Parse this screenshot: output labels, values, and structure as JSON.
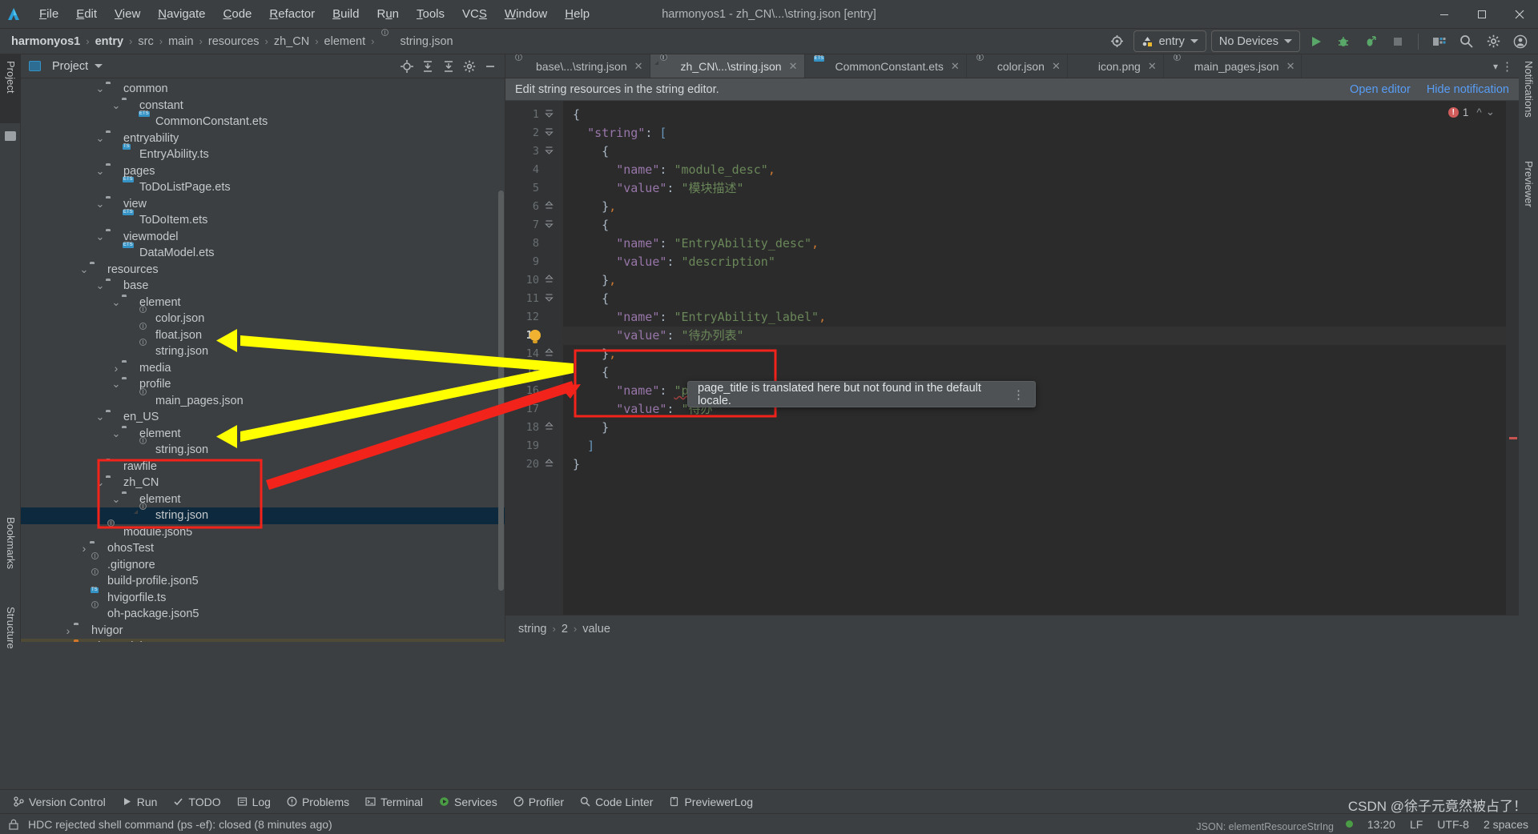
{
  "titlebar": {
    "window_title": "harmonyos1 - zh_CN\\...\\string.json [entry]",
    "menu": [
      "File",
      "Edit",
      "View",
      "Navigate",
      "Code",
      "Refactor",
      "Build",
      "Run",
      "Tools",
      "VCS",
      "Window",
      "Help"
    ],
    "controls": {
      "minimize": "─",
      "maximize": "☐",
      "close": "✕"
    }
  },
  "navbar": {
    "crumbs": [
      "harmonyos1",
      "entry",
      "src",
      "main",
      "resources",
      "zh_CN",
      "element",
      "string.json"
    ],
    "separator": "›",
    "run_config": "entry",
    "device_selector": "No Devices",
    "icons": [
      "target-icon",
      "run-icon",
      "debug-icon",
      "profile-run-icon",
      "stop-icon",
      "device-manager-icon",
      "search-icon",
      "settings-icon",
      "account-icon"
    ]
  },
  "left_strip": {
    "tabs": [
      "Project",
      "Bookmarks",
      "Structure"
    ]
  },
  "right_strip": {
    "tabs": [
      "Notifications",
      "Previewer"
    ]
  },
  "project_panel": {
    "title": "Project",
    "header_icons": [
      "locate-icon",
      "expand-all-icon",
      "collapse-all-icon",
      "settings-icon",
      "hide-icon"
    ],
    "tree": [
      {
        "label": "common",
        "indent": 4,
        "type": "folder",
        "state": "open"
      },
      {
        "label": "constant",
        "indent": 5,
        "type": "folder",
        "state": "open"
      },
      {
        "label": "CommonConstant.ets",
        "indent": 6,
        "type": "ets"
      },
      {
        "label": "entryability",
        "indent": 4,
        "type": "folder",
        "state": "open"
      },
      {
        "label": "EntryAbility.ts",
        "indent": 5,
        "type": "ts"
      },
      {
        "label": "pages",
        "indent": 4,
        "type": "folder",
        "state": "open"
      },
      {
        "label": "ToDoListPage.ets",
        "indent": 5,
        "type": "ets"
      },
      {
        "label": "view",
        "indent": 4,
        "type": "folder",
        "state": "open"
      },
      {
        "label": "ToDoItem.ets",
        "indent": 5,
        "type": "ets"
      },
      {
        "label": "viewmodel",
        "indent": 4,
        "type": "folder",
        "state": "open"
      },
      {
        "label": "DataModel.ets",
        "indent": 5,
        "type": "ets"
      },
      {
        "label": "resources",
        "indent": 3,
        "type": "folder",
        "state": "open"
      },
      {
        "label": "base",
        "indent": 4,
        "type": "folder",
        "state": "open"
      },
      {
        "label": "element",
        "indent": 5,
        "type": "folder",
        "state": "open"
      },
      {
        "label": "color.json",
        "indent": 6,
        "type": "json"
      },
      {
        "label": "float.json",
        "indent": 6,
        "type": "json"
      },
      {
        "label": "string.json",
        "indent": 6,
        "type": "json"
      },
      {
        "label": "media",
        "indent": 5,
        "type": "folder",
        "state": "closed"
      },
      {
        "label": "profile",
        "indent": 5,
        "type": "folder",
        "state": "open"
      },
      {
        "label": "main_pages.json",
        "indent": 6,
        "type": "json"
      },
      {
        "label": "en_US",
        "indent": 4,
        "type": "folder",
        "state": "open"
      },
      {
        "label": "element",
        "indent": 5,
        "type": "folder",
        "state": "open"
      },
      {
        "label": "string.json",
        "indent": 6,
        "type": "json"
      },
      {
        "label": "rawfile",
        "indent": 4,
        "type": "folder",
        "state": "none"
      },
      {
        "label": "zh_CN",
        "indent": 4,
        "type": "folder",
        "state": "open"
      },
      {
        "label": "element",
        "indent": 5,
        "type": "folder",
        "state": "open"
      },
      {
        "label": "string.json",
        "indent": 6,
        "type": "json",
        "selected": true
      },
      {
        "label": "module.json5",
        "indent": 4,
        "type": "json"
      },
      {
        "label": "ohosTest",
        "indent": 3,
        "type": "folder",
        "state": "closed"
      },
      {
        "label": ".gitignore",
        "indent": 3,
        "type": "gitignore"
      },
      {
        "label": "build-profile.json5",
        "indent": 3,
        "type": "json"
      },
      {
        "label": "hvigorfile.ts",
        "indent": 3,
        "type": "ts"
      },
      {
        "label": "oh-package.json5",
        "indent": 3,
        "type": "json"
      },
      {
        "label": "hvigor",
        "indent": 2,
        "type": "folder",
        "state": "closed"
      },
      {
        "label": "oh_modules",
        "indent": 2,
        "type": "folder-orange",
        "state": "closed",
        "highlight": true
      }
    ]
  },
  "editor": {
    "tabs": [
      {
        "label": "base\\...\\string.json",
        "icon": "json-icon",
        "active": false
      },
      {
        "label": "zh_CN\\...\\string.json",
        "icon": "json-icon",
        "active": true
      },
      {
        "label": "CommonConstant.ets",
        "icon": "ets-icon",
        "active": false
      },
      {
        "label": "color.json",
        "icon": "json-icon",
        "active": false
      },
      {
        "label": "icon.png",
        "icon": "image-icon",
        "active": false
      },
      {
        "label": "main_pages.json",
        "icon": "json-icon",
        "active": false
      }
    ],
    "notification": {
      "text": "Edit string resources in the string editor.",
      "open_editor": "Open editor",
      "hide_notification": "Hide notification"
    },
    "inspection_count": "1",
    "lines": [
      {
        "n": "1",
        "text": "{",
        "fold": "open"
      },
      {
        "n": "2",
        "text": "  \"string\": [",
        "fold": "open"
      },
      {
        "n": "3",
        "text": "    {",
        "fold": "open"
      },
      {
        "n": "4",
        "text": "      \"name\": \"module_desc\","
      },
      {
        "n": "5",
        "text": "      \"value\": \"模块描述\""
      },
      {
        "n": "6",
        "text": "    },",
        "fold": "end"
      },
      {
        "n": "7",
        "text": "    {",
        "fold": "open"
      },
      {
        "n": "8",
        "text": "      \"name\": \"EntryAbility_desc\","
      },
      {
        "n": "9",
        "text": "      \"value\": \"description\""
      },
      {
        "n": "10",
        "text": "    },",
        "fold": "end"
      },
      {
        "n": "11",
        "text": "    {",
        "fold": "open"
      },
      {
        "n": "12",
        "text": "      \"name\": \"EntryAbility_label\","
      },
      {
        "n": "13",
        "text": "      \"value\": \"待办列表\"",
        "current": true,
        "bulb": true
      },
      {
        "n": "14",
        "text": "    },",
        "fold": "end"
      },
      {
        "n": "15",
        "text": "    {",
        "fold": "open"
      },
      {
        "n": "16",
        "text": "      \"name\": \"page_title\","
      },
      {
        "n": "17",
        "text": "      \"value\": \"待办\""
      },
      {
        "n": "18",
        "text": "    }",
        "fold": "end"
      },
      {
        "n": "19",
        "text": "  ]"
      },
      {
        "n": "20",
        "text": "}",
        "fold": "end"
      }
    ],
    "tooltip": {
      "text": "page_title is translated here but not found in the default locale.",
      "more": "⋮"
    },
    "breadcrumb": [
      "string",
      "2",
      "value"
    ],
    "breadcrumb_sep": "›"
  },
  "bottom_bar": {
    "items": [
      {
        "label": "Version Control",
        "icon": "branch-icon"
      },
      {
        "label": "Run",
        "icon": "play-icon"
      },
      {
        "label": "TODO",
        "icon": "check-icon"
      },
      {
        "label": "Log",
        "icon": "log-icon"
      },
      {
        "label": "Problems",
        "icon": "warning-icon"
      },
      {
        "label": "Terminal",
        "icon": "terminal-icon"
      },
      {
        "label": "Services",
        "icon": "services-icon"
      },
      {
        "label": "Profiler",
        "icon": "profiler-icon"
      },
      {
        "label": "Code Linter",
        "icon": "magnifier-icon"
      },
      {
        "label": "PreviewerLog",
        "icon": "previewer-icon"
      }
    ]
  },
  "status_bar": {
    "message": "HDC rejected shell command (ps -ef): closed (8 minutes ago)",
    "time": "13:20",
    "line_sep": "LF",
    "encoding": "UTF-8",
    "indent": "2 spaces",
    "lock_icon": "lock-icon"
  },
  "watermark": {
    "line1": "CSDN @徐子元竟然被占了！",
    "line2": "JSON: elementResourceStrIng"
  }
}
